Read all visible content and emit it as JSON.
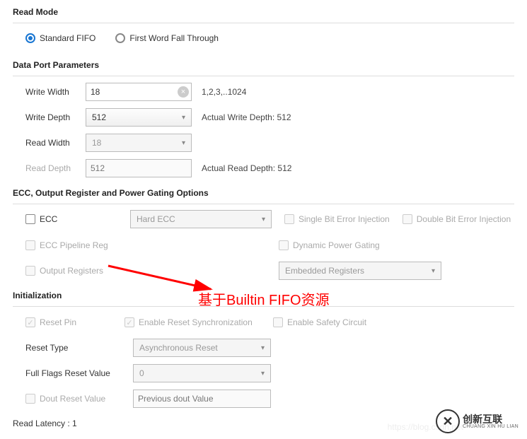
{
  "read_mode": {
    "title": "Read Mode",
    "opt1": "Standard FIFO",
    "opt2": "First Word Fall Through"
  },
  "dpp": {
    "title": "Data Port Parameters",
    "write_width_label": "Write Width",
    "write_width_value": "18",
    "write_width_hint": "1,2,3,..1024",
    "write_depth_label": "Write Depth",
    "write_depth_value": "512",
    "write_depth_hint": "Actual Write Depth: 512",
    "read_width_label": "Read Width",
    "read_width_value": "18",
    "read_depth_label": "Read Depth",
    "read_depth_value": "512",
    "read_depth_hint": "Actual Read Depth: 512"
  },
  "ecc": {
    "title": "ECC, Output Register and Power Gating Options",
    "ecc_label": "ECC",
    "type_value": "Hard ECC",
    "sbit": "Single Bit Error Injection",
    "dbit": "Double Bit Error Injection",
    "pipeline": "ECC Pipeline Reg",
    "dpg": "Dynamic Power Gating",
    "outreg": "Output Registers",
    "outreg_val": "Embedded Registers"
  },
  "annotation": "基于Builtin FIFO资源",
  "init": {
    "title": "Initialization",
    "reset_pin": "Reset Pin",
    "enable_sync": "Enable Reset Synchronization",
    "safety": "Enable Safety Circuit",
    "reset_type_label": "Reset Type",
    "reset_type_value": "Asynchronous Reset",
    "full_flags_label": "Full Flags Reset Value",
    "full_flags_value": "0",
    "dout_label": "Dout Reset Value",
    "dout_value": "Previous dout Value"
  },
  "read_latency": "Read Latency : 1",
  "faint": "https://blog.csdn.net",
  "logo_cn": "创新互联",
  "logo_en": "CHUANG XIN HU LIAN"
}
